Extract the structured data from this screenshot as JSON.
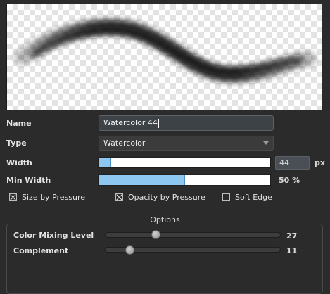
{
  "name_field": {
    "label": "Name",
    "value": "Watercolor 44"
  },
  "type_field": {
    "label": "Type",
    "value": "Watercolor"
  },
  "width_field": {
    "label": "Width",
    "value": "44",
    "unit": "px",
    "fraction": 0.07
  },
  "min_width_field": {
    "label": "Min Width",
    "value_text": "50 %",
    "percent": 50
  },
  "checkboxes": {
    "size_by_pressure": {
      "label": "Size by Pressure",
      "checked": true
    },
    "opacity_by_pressure": {
      "label": "Opacity by Pressure",
      "checked": true
    },
    "soft_edge": {
      "label": "Soft Edge",
      "checked": false
    }
  },
  "options": {
    "title": "Options",
    "color_mixing_level": {
      "label": "Color Mixing Level",
      "value": "27"
    },
    "complement": {
      "label": "Complement",
      "value": "11"
    }
  },
  "colors": {
    "background": "#2b2b2b",
    "bar_fill": "#8ec6f2",
    "stroke": "#1a1a1a"
  }
}
